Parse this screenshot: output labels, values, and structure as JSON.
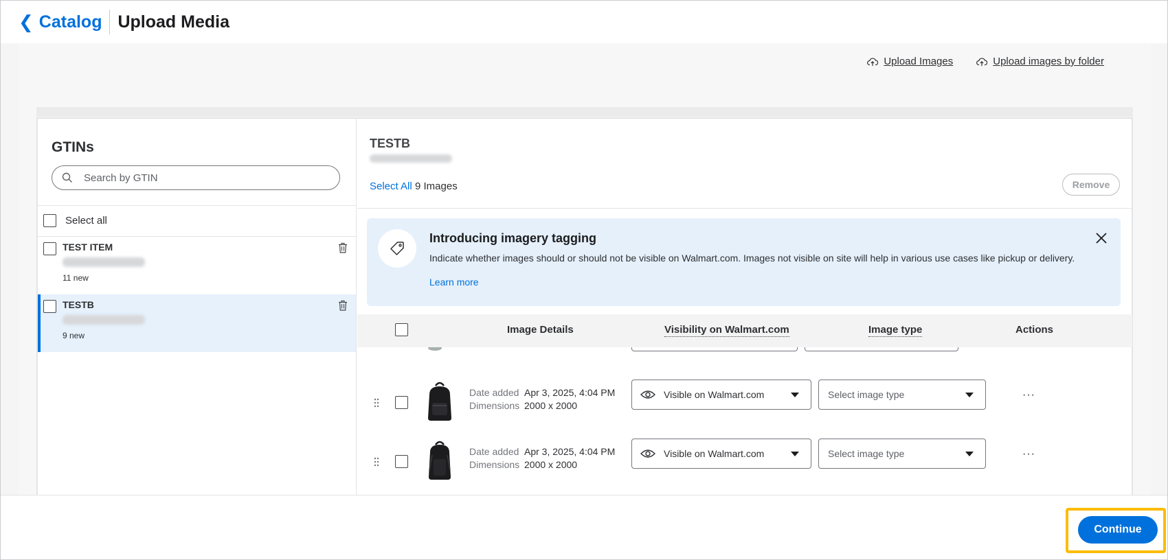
{
  "header": {
    "back_label": "Catalog",
    "title": "Upload Media"
  },
  "uploads": {
    "upload_images": "Upload Images",
    "upload_by_folder": "Upload images by folder"
  },
  "left": {
    "title": "GTINs",
    "search_placeholder": "Search by GTIN",
    "select_all": "Select all",
    "items": [
      {
        "name": "TEST ITEM",
        "new_count": "11 new"
      },
      {
        "name": "TESTB",
        "new_count": "9 new"
      }
    ]
  },
  "right": {
    "item_title": "TESTB",
    "select_all": "Select All",
    "image_count": "9 Images",
    "remove": "Remove",
    "banner": {
      "title": "Introducing imagery tagging",
      "text": "Indicate whether images should or should not be visible on Walmart.com. Images not visible on site will help in various use cases like pickup or delivery.",
      "learn_more": "Learn more"
    },
    "columns": {
      "details": "Image Details",
      "visibility": "Visibility on Walmart.com",
      "type": "Image type",
      "actions": "Actions"
    },
    "rows": [
      {
        "date_label": "Date added",
        "date": "Apr 3, 2025, 4:04 PM",
        "dim_label": "Dimensions",
        "dimensions": "2000 x 2000",
        "visibility": "Visible on Walmart.com",
        "type_placeholder": "Select image type",
        "actions": "···"
      },
      {
        "date_label": "Date added",
        "date": "Apr 3, 2025, 4:04 PM",
        "dim_label": "Dimensions",
        "dimensions": "2000 x 2000",
        "visibility": "Visible on Walmart.com",
        "type_placeholder": "Select image type",
        "actions": "···"
      }
    ]
  },
  "footer": {
    "continue": "Continue"
  },
  "colors": {
    "accent": "#0071dc",
    "highlight": "#fbbc05",
    "banner_bg": "#e5f0fb",
    "selected_bg": "#e6f1fc"
  }
}
